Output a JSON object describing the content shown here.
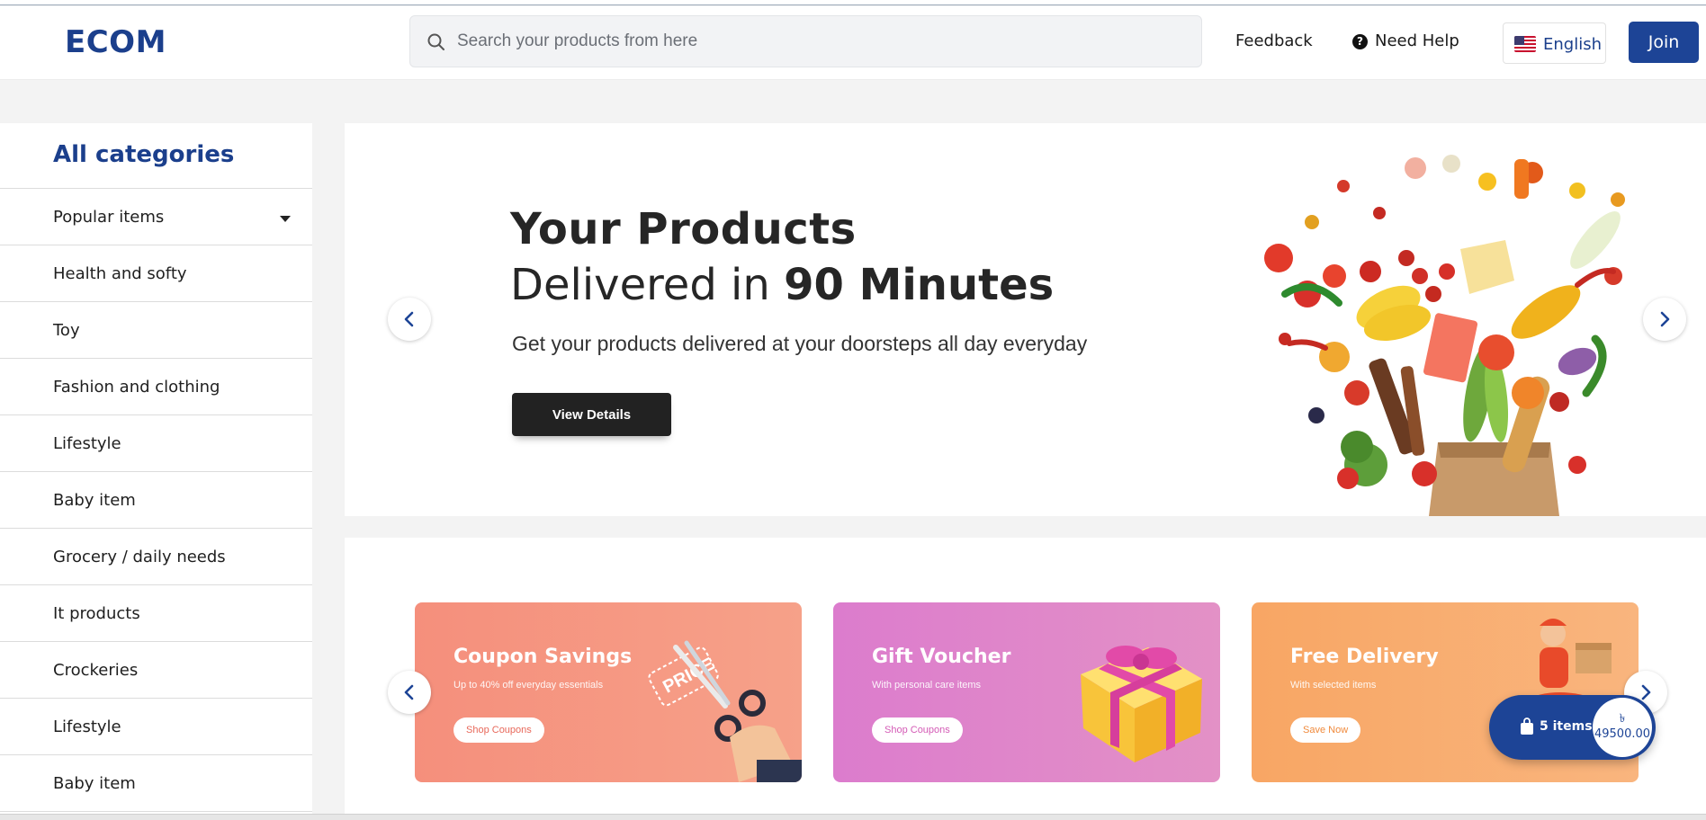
{
  "header": {
    "logo": "ECOM",
    "search_placeholder": "Search your products from here",
    "feedback": "Feedback",
    "help": "Need Help",
    "language": "English",
    "join": "Join"
  },
  "sidebar": {
    "title": "All categories",
    "items": [
      {
        "label": "Popular items"
      },
      {
        "label": "Health and softy"
      },
      {
        "label": "Toy"
      },
      {
        "label": "Fashion and clothing"
      },
      {
        "label": "Lifestyle"
      },
      {
        "label": "Baby item"
      },
      {
        "label": "Grocery / daily needs"
      },
      {
        "label": "It products"
      },
      {
        "label": "Crockeries"
      },
      {
        "label": "Lifestyle"
      },
      {
        "label": "Baby item"
      }
    ]
  },
  "hero": {
    "line1": "Your Products",
    "line2_prefix": "Delivered in ",
    "line2_bold": "90 Minutes",
    "subtitle": "Get your products delivered at your doorsteps all day everyday",
    "button": "View Details"
  },
  "promos": [
    {
      "title": "Coupon Savings",
      "subtitle": "Up to 40% off everyday essentials",
      "button": "Shop Coupons",
      "color": "#f4907f",
      "btn_color": "#e8685a",
      "art_text": "PRICE"
    },
    {
      "title": "Gift Voucher",
      "subtitle": "With personal care items",
      "button": "Shop Coupons",
      "color": "#df86c9",
      "btn_color": "#d45bb6"
    },
    {
      "title": "Free Delivery",
      "subtitle": "With selected items",
      "button": "Save Now",
      "color": "#f8ad6e",
      "btn_color": "#f08a3c"
    }
  ],
  "cart": {
    "items": "5 items",
    "currency": "৳",
    "amount": "49500.00"
  },
  "colors": {
    "brand": "#1d4496",
    "hero_button": "#222222"
  }
}
